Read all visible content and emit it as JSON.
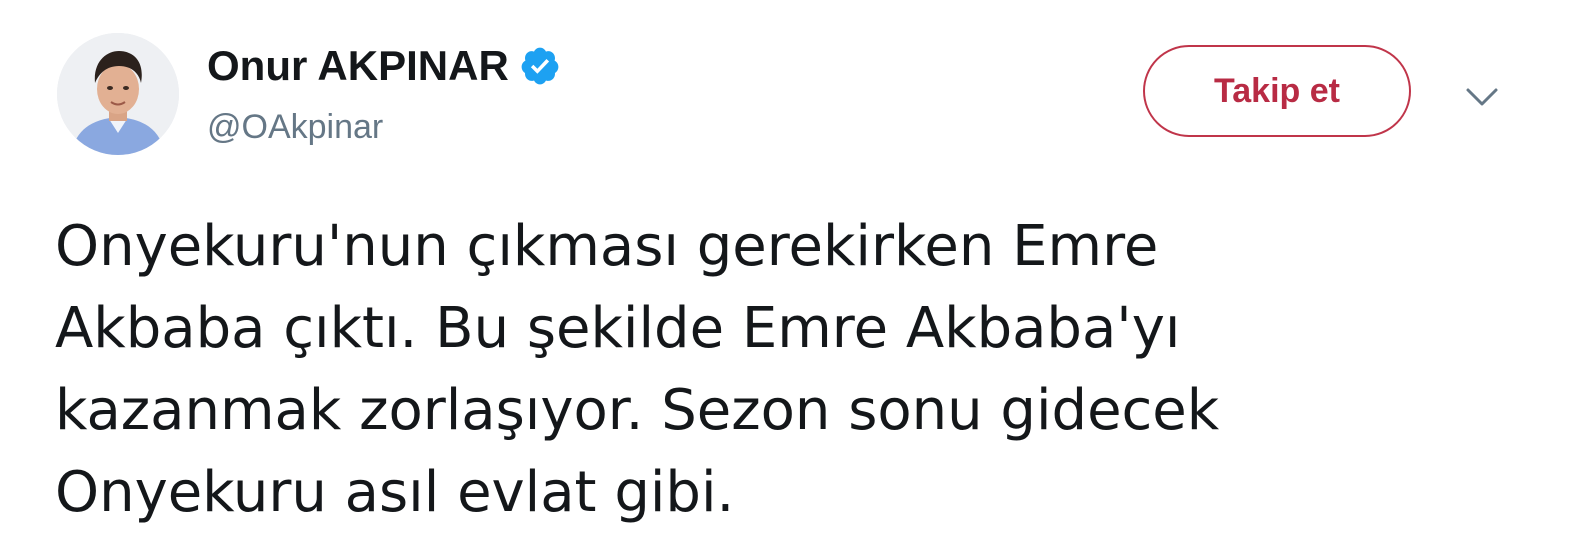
{
  "tweet": {
    "author": {
      "display_name": "Onur AKPINAR",
      "handle": "@OAkpinar",
      "verified": true,
      "avatar_icon": "profile-photo"
    },
    "follow_button_label": "Takip et",
    "menu_icon": "chevron-down-icon",
    "text": "Onyekuru'nun çıkması gerekirken Emre\nAkbaba çıktı. Bu şekilde Emre Akbaba'yı\nkazanmak zorlaşıyor. Sezon sonu gidecek\nOnyekuru asıl evlat gibi."
  },
  "colors": {
    "verified_badge": "#1da1f2",
    "follow_accent": "#b82b44",
    "handle_gray": "#657786",
    "text": "#14171a"
  }
}
